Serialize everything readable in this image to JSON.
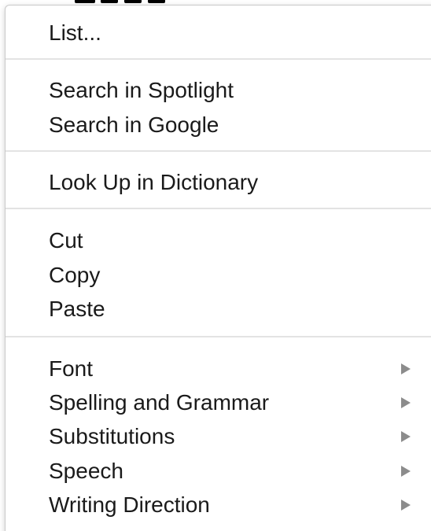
{
  "context_menu": {
    "items": [
      {
        "label": "List..."
      },
      {
        "label": "Search in Spotlight"
      },
      {
        "label": "Search in Google"
      },
      {
        "label": "Look Up in Dictionary"
      },
      {
        "label": "Cut"
      },
      {
        "label": "Copy"
      },
      {
        "label": "Paste"
      },
      {
        "label": "Font",
        "submenu": true
      },
      {
        "label": "Spelling and Grammar",
        "submenu": true
      },
      {
        "label": "Substitutions",
        "submenu": true
      },
      {
        "label": "Speech",
        "submenu": true
      },
      {
        "label": "Writing Direction",
        "submenu": true
      }
    ],
    "submenu_arrow_icon": "triangle-right-icon",
    "colors": {
      "text": "#1a1a1a",
      "separator": "#e3e3e3",
      "arrow": "#8c8c8c",
      "background": "#ffffff"
    }
  }
}
